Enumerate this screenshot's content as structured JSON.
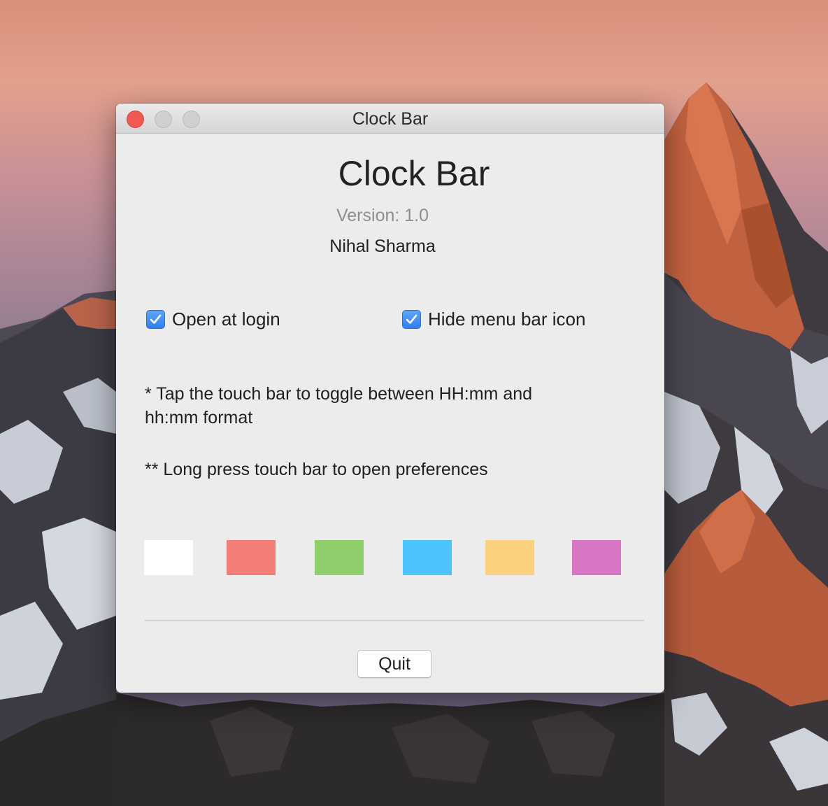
{
  "window": {
    "title": "Clock Bar",
    "controls": [
      "close",
      "minimize",
      "zoom"
    ]
  },
  "app": {
    "name": "Clock Bar",
    "version": "Version: 1.0",
    "author": "Nihal Sharma"
  },
  "options": [
    {
      "label": "Open at login",
      "checked": true
    },
    {
      "label": "Hide menu bar icon",
      "checked": true
    }
  ],
  "notes": {
    "tap_line1": "* Tap the touch bar to toggle between HH:mm and",
    "tap_line2": "hh:mm format",
    "long_press": "** Long press touch bar to open preferences"
  },
  "colors": [
    "#ffffff",
    "#f37e78",
    "#8ecf6c",
    "#4dc3fb",
    "#fbd07e",
    "#d775c4"
  ],
  "buttons": {
    "quit": "Quit"
  }
}
